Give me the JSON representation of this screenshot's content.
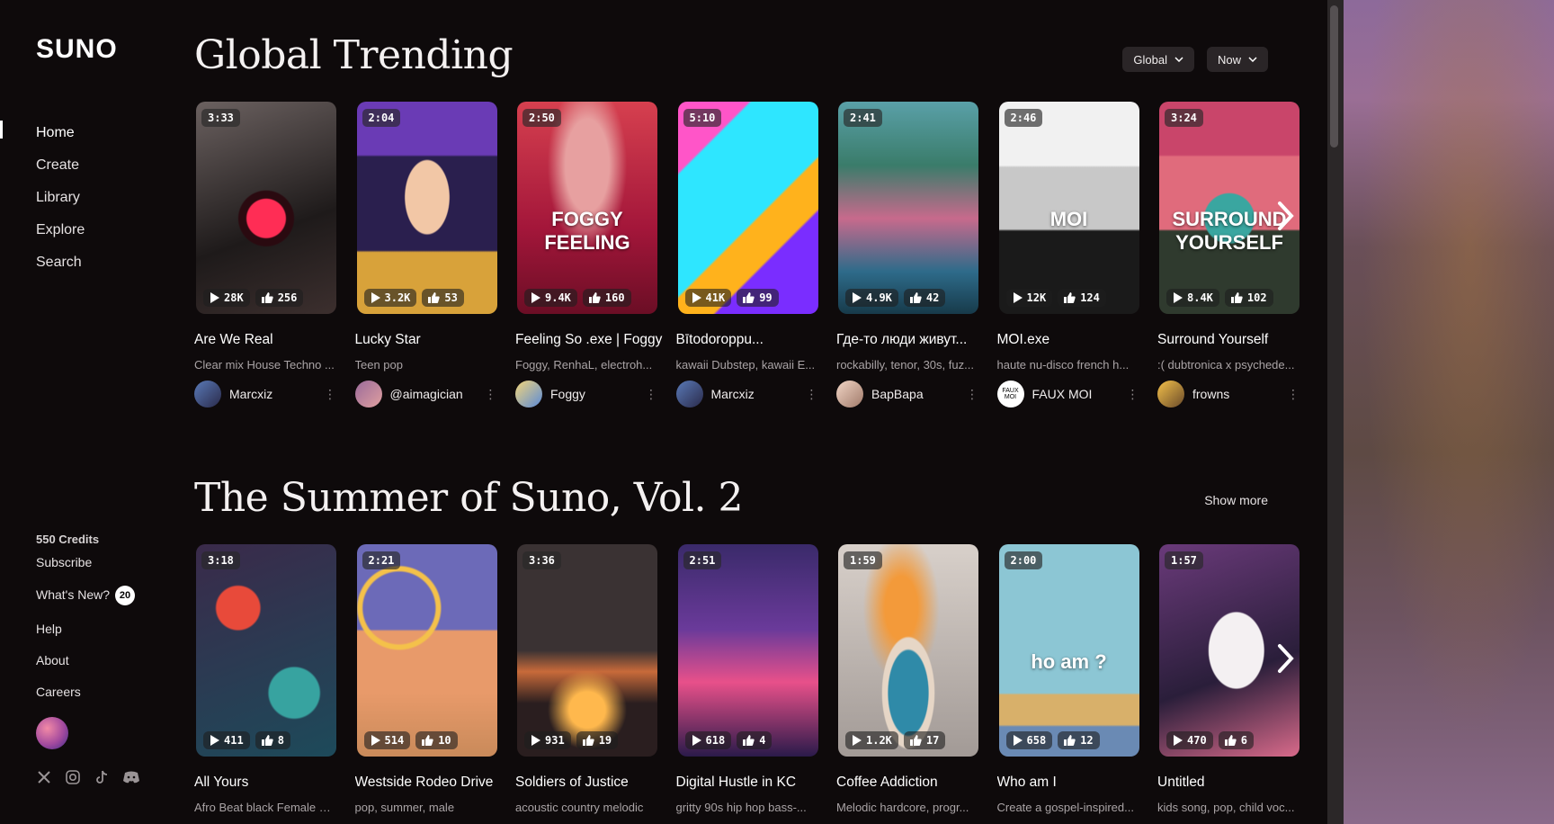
{
  "sidebar": {
    "logo": "SUNO",
    "nav": [
      {
        "label": "Home",
        "active": true
      },
      {
        "label": "Create"
      },
      {
        "label": "Library"
      },
      {
        "label": "Explore"
      },
      {
        "label": "Search"
      }
    ],
    "credits": "550 Credits",
    "subscribe": "Subscribe",
    "whats_new": "What's New?",
    "whats_new_count": "20",
    "help": "Help",
    "about": "About",
    "careers": "Careers",
    "socials": [
      "x-icon",
      "instagram-icon",
      "tiktok-icon",
      "discord-icon"
    ]
  },
  "trending": {
    "title": "Global Trending",
    "region_filter": "Global",
    "time_filter": "Now",
    "songs": [
      {
        "duration": "3:33",
        "plays": "28K",
        "likes": "256",
        "title": "Are We Real",
        "desc": "Clear mix House Techno ...",
        "artist": "Marcxiz"
      },
      {
        "duration": "2:04",
        "plays": "3.2K",
        "likes": "53",
        "title": "Lucky Star",
        "desc": "Teen pop",
        "artist": "@aimagician"
      },
      {
        "duration": "2:50",
        "plays": "9.4K",
        "likes": "160",
        "title": "Feeling So .exe | Foggy",
        "desc": "Foggy, RenhaL, electroh...",
        "artist": "Foggy",
        "art_text": "FOGGY FEELING"
      },
      {
        "duration": "5:10",
        "plays": "41K",
        "likes": "99",
        "title": "Bītodoroppu...",
        "desc": "kawaii Dubstep, kawaii E...",
        "artist": "Marcxiz"
      },
      {
        "duration": "2:41",
        "plays": "4.9K",
        "likes": "42",
        "title": "Где-то люди живут...",
        "desc": "rockabilly, tenor, 30s, fuz...",
        "artist": "BapBapa"
      },
      {
        "duration": "2:46",
        "plays": "12K",
        "likes": "124",
        "title": "MOI.exe",
        "desc": "haute nu-disco french h...",
        "artist": "FAUX MOI",
        "art_text": "MOI",
        "avatar_text": "FAUX MOI"
      },
      {
        "duration": "3:24",
        "plays": "8.4K",
        "likes": "102",
        "title": "Surround Yourself",
        "desc": ":( dubtronica x psychede...",
        "artist": "frowns",
        "art_text": "SURROUND YOURSELF"
      }
    ]
  },
  "summer": {
    "title": "The Summer of Suno, Vol. 2",
    "show_more": "Show more",
    "songs": [
      {
        "duration": "3:18",
        "plays": "411",
        "likes": "8",
        "title": "All Yours",
        "desc": "Afro Beat black Female V..."
      },
      {
        "duration": "2:21",
        "plays": "514",
        "likes": "10",
        "title": "Westside Rodeo Drive",
        "desc": "pop, summer, male"
      },
      {
        "duration": "3:36",
        "plays": "931",
        "likes": "19",
        "title": "Soldiers of Justice",
        "desc": "acoustic country melodic"
      },
      {
        "duration": "2:51",
        "plays": "618",
        "likes": "4",
        "title": "Digital Hustle in KC",
        "desc": "gritty 90s hip hop bass-..."
      },
      {
        "duration": "1:59",
        "plays": "1.2K",
        "likes": "17",
        "title": "Coffee Addiction",
        "desc": "Melodic hardcore, progr..."
      },
      {
        "duration": "2:00",
        "plays": "658",
        "likes": "12",
        "title": "Who am I",
        "desc": "Create a gospel-inspired...",
        "art_text": "ho am ?"
      },
      {
        "duration": "1:57",
        "plays": "470",
        "likes": "6",
        "title": "Untitled",
        "desc": "kids song, pop, child voc..."
      }
    ]
  },
  "colors": {
    "background": "#0e0a0b",
    "dropdown_bg": "#2a2527",
    "muted_text": "#a9a3a5"
  }
}
